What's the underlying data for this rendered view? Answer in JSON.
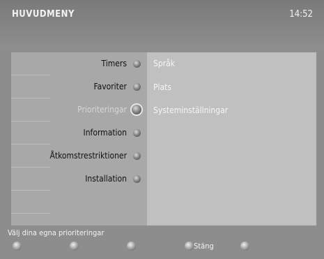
{
  "header": {
    "title": "HUVUDMENY",
    "clock": "14:52"
  },
  "menu": {
    "items": [
      {
        "label": "Timers"
      },
      {
        "label": "Favoriter"
      },
      {
        "label": "Prioriteringar"
      },
      {
        "label": "Information"
      },
      {
        "label": "Åtkomstrestriktioner"
      },
      {
        "label": "Installation"
      }
    ],
    "selected": "Prioriteringar"
  },
  "submenu": {
    "items": [
      "Språk",
      "Plats",
      "Systeminställningar"
    ]
  },
  "footer": {
    "hint": "Välj dina egna prioriteringar",
    "close_label": "Stäng"
  }
}
